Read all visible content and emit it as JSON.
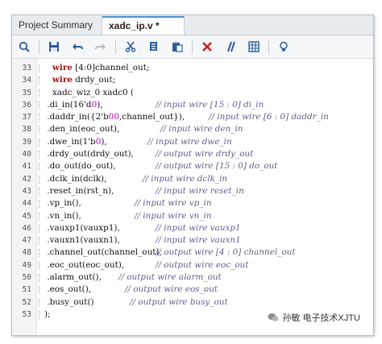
{
  "tabs": [
    {
      "label": "Project Summary",
      "active": false
    },
    {
      "label": "xadc_ip.v *",
      "active": true
    }
  ],
  "toolbar": {
    "icons": [
      "search-icon",
      "save-icon",
      "undo-icon",
      "redo-icon",
      "cut-icon",
      "copy-icon",
      "paste-icon",
      "delete-icon",
      "comment-icon",
      "columns-icon",
      "lightbulb-icon"
    ]
  },
  "editor": {
    "lines": [
      {
        "n": "33",
        "pre": "   ",
        "kw": "wire",
        "code": " [4:0]channel_out;",
        "comment": "",
        "cpos": 0
      },
      {
        "n": "34",
        "pre": "   ",
        "kw": "wire",
        "code": " drdy_out;",
        "comment": "",
        "cpos": 0
      },
      {
        "n": "35",
        "pre": "   ",
        "kw": "",
        "code": "xadc_wiz_0 xadc0 (",
        "comment": "",
        "cpos": 0
      },
      {
        "n": "36",
        "pre": " ",
        "kw": "",
        "code": ".di_in(16'd0),",
        "comment": "// input wire [15 : 0] di_in",
        "cpos": 178
      },
      {
        "n": "37",
        "pre": " ",
        "kw": "",
        "code": ".daddr_in({2'b00,channel_out}),",
        "comment": "// input wire [6 : 0] daddr_in",
        "cpos": 244
      },
      {
        "n": "38",
        "pre": " ",
        "kw": "",
        "code": ".den_in(eoc_out),",
        "comment": "// input wire den_in",
        "cpos": 184
      },
      {
        "n": "39",
        "pre": " ",
        "kw": "",
        "code": ".dwe_in(1'b0),",
        "comment": "// input wire dwe_in",
        "cpos": 168
      },
      {
        "n": "40",
        "pre": " ",
        "kw": "",
        "code": ".drdy_out(drdy_out),",
        "comment": "// output wire drdy_out",
        "cpos": 178
      },
      {
        "n": "41",
        "pre": " ",
        "kw": "",
        "code": ".do_out(do_out),",
        "comment": "// output wire [15 : 0] do_out",
        "cpos": 178
      },
      {
        "n": "42",
        "pre": " ",
        "kw": "",
        "code": ".dclk_in(dclk),",
        "comment": "// input wire dclk_in",
        "cpos": 162
      },
      {
        "n": "43",
        "pre": " ",
        "kw": "",
        "code": ".reset_in(rst_n),",
        "comment": "// input wire reset_in",
        "cpos": 178
      },
      {
        "n": "44",
        "pre": " ",
        "kw": "",
        "code": ".vp_in(),",
        "comment": "// input wire vp_in",
        "cpos": 152
      },
      {
        "n": "45",
        "pre": " ",
        "kw": "",
        "code": ".vn_in(),",
        "comment": "// input wire vn_in",
        "cpos": 152
      },
      {
        "n": "46",
        "pre": " ",
        "kw": "",
        "code": ".vauxp1(vauxp1),",
        "comment": "// input wire vauxp1",
        "cpos": 178
      },
      {
        "n": "47",
        "pre": " ",
        "kw": "",
        "code": ".vauxn1(vauxn1),",
        "comment": "// input wire vauxn1",
        "cpos": 178
      },
      {
        "n": "48",
        "pre": " ",
        "kw": "",
        "code": ".channel_out(channel_out),",
        "comment": "// output wire [4 : 0] channel_out",
        "cpos": 178
      },
      {
        "n": "49",
        "pre": " ",
        "kw": "",
        "code": ".eoc_out(eoc_out),",
        "comment": "// output wire eoc_out",
        "cpos": 178
      },
      {
        "n": "50",
        "pre": " ",
        "kw": "",
        "code": ".alarm_out(),",
        "comment": "// output wire alarm_out",
        "cpos": 132
      },
      {
        "n": "51",
        "pre": " ",
        "kw": "",
        "code": ".eos_out(),",
        "comment": "// output wire eos_out",
        "cpos": 140
      },
      {
        "n": "52",
        "pre": " ",
        "kw": "",
        "code": ".busy_out()",
        "comment": "// output wire busy_out",
        "cpos": 146
      },
      {
        "n": "53",
        "pre": "",
        "kw": "",
        "code": ");",
        "comment": "",
        "cpos": 0
      }
    ]
  },
  "watermark": {
    "text": "孙敏 电子技术XJTU"
  },
  "colors": {
    "keyword": "#a41414",
    "comment": "#5f5f8a",
    "number": "#c000c0",
    "accent": "#4a8fd6"
  }
}
